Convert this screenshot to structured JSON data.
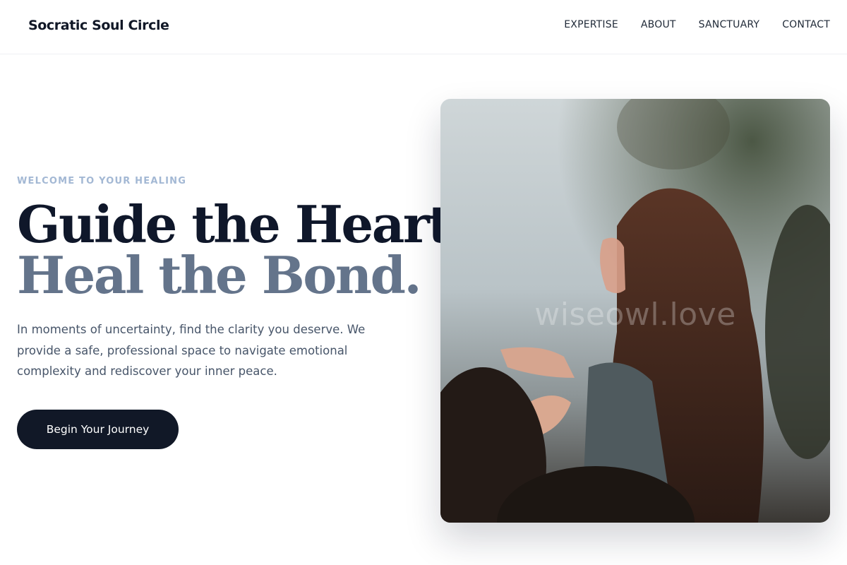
{
  "header": {
    "brand": "Socratic Soul Circle",
    "nav": [
      {
        "label": "EXPERTISE"
      },
      {
        "label": "ABOUT"
      },
      {
        "label": "SANCTUARY"
      },
      {
        "label": "CONTACT"
      }
    ]
  },
  "hero": {
    "eyebrow": "WELCOME TO YOUR HEALING",
    "headline_line1": "Guide the Heart,",
    "headline_line2": "Heal the Bond.",
    "lead": "In moments of uncertainty, find the clarity you deserve. We provide a safe, professional space to navigate emotional complexity and rediscover your inner peace.",
    "cta_label": "Begin Your Journey",
    "image_watermark": "wiseowl.love"
  },
  "colors": {
    "primary_dark": "#111827",
    "headline_muted": "#64748b",
    "eyebrow": "#a3b8d4",
    "body_text": "#475569"
  }
}
